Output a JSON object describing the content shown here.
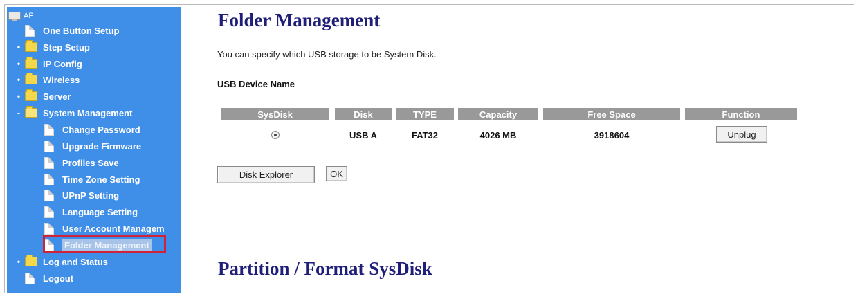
{
  "sidebar": {
    "root_label": "AP",
    "items": [
      {
        "label": "One Button Setup"
      },
      {
        "label": "Step Setup"
      },
      {
        "label": "IP Config"
      },
      {
        "label": "Wireless"
      },
      {
        "label": "Server"
      },
      {
        "label": "System Management"
      },
      {
        "label": "Change Password"
      },
      {
        "label": "Upgrade Firmware"
      },
      {
        "label": "Profiles Save"
      },
      {
        "label": "Time Zone Setting"
      },
      {
        "label": "UPnP Setting"
      },
      {
        "label": "Language Setting"
      },
      {
        "label": "User Account Managem"
      },
      {
        "label": "Folder Management"
      },
      {
        "label": "Log and Status"
      },
      {
        "label": "Logout"
      }
    ]
  },
  "main": {
    "title": "Folder Management",
    "description": "You can specify which USB storage to be System Disk.",
    "section_label": "USB Device Name",
    "table": {
      "headers": [
        "SysDisk",
        "Disk",
        "TYPE",
        "Capacity",
        "Free Space",
        "Function"
      ],
      "rows": [
        {
          "disk": "USB A",
          "type": "FAT32",
          "capacity": "4026 MB",
          "free_space": "3918604",
          "function_label": "Unplug"
        }
      ]
    },
    "disk_explorer_label": "Disk Explorer",
    "ok_label": "OK",
    "section2_title": "Partition / Format SysDisk"
  },
  "colors": {
    "sidebar_bg": "#3f8ee8",
    "title": "#1f1f7a",
    "table_header_bg": "#999999",
    "highlight_border": "#d0233a"
  }
}
